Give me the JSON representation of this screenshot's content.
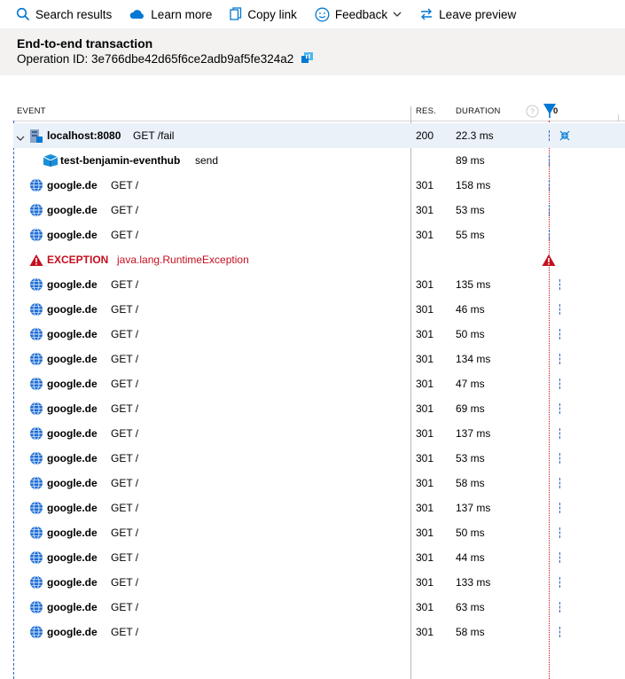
{
  "toolbar": {
    "search_results": "Search results",
    "learn_more": "Learn more",
    "copy_link": "Copy link",
    "feedback": "Feedback",
    "leave_preview": "Leave preview"
  },
  "header": {
    "title": "End-to-end transaction",
    "operation_id": "Operation ID: 3e766dbe42d65f6ce2adb9af5fe324a2"
  },
  "columns": {
    "event": "EVENT",
    "res": "RES.",
    "duration": "DURATION",
    "timeline_zero": "0"
  },
  "colors": {
    "accent": "#0078d4",
    "error": "#c50f1f",
    "header_bg": "#f3f2f1",
    "selected_row": "#eaf1f9"
  },
  "rows": [
    {
      "icon": "server-icon",
      "name": "localhost:8080",
      "detail": "GET /fail",
      "res": "200",
      "duration": "22.3 ms"
    },
    {
      "icon": "eventhub-icon",
      "name": "test-benjamin-eventhub",
      "detail": "send",
      "res": "",
      "duration": "89 ms"
    },
    {
      "icon": "globe-icon",
      "name": "google.de",
      "detail": "GET /",
      "res": "301",
      "duration": "158 ms"
    },
    {
      "icon": "globe-icon",
      "name": "google.de",
      "detail": "GET /",
      "res": "301",
      "duration": "53 ms"
    },
    {
      "icon": "globe-icon",
      "name": "google.de",
      "detail": "GET /",
      "res": "301",
      "duration": "55 ms"
    },
    {
      "icon": "warning-icon",
      "name": "EXCEPTION",
      "detail": "java.lang.RuntimeException",
      "res": "",
      "duration": ""
    },
    {
      "icon": "globe-icon",
      "name": "google.de",
      "detail": "GET /",
      "res": "301",
      "duration": "135 ms"
    },
    {
      "icon": "globe-icon",
      "name": "google.de",
      "detail": "GET /",
      "res": "301",
      "duration": "46 ms"
    },
    {
      "icon": "globe-icon",
      "name": "google.de",
      "detail": "GET /",
      "res": "301",
      "duration": "50 ms"
    },
    {
      "icon": "globe-icon",
      "name": "google.de",
      "detail": "GET /",
      "res": "301",
      "duration": "134 ms"
    },
    {
      "icon": "globe-icon",
      "name": "google.de",
      "detail": "GET /",
      "res": "301",
      "duration": "47 ms"
    },
    {
      "icon": "globe-icon",
      "name": "google.de",
      "detail": "GET /",
      "res": "301",
      "duration": "69 ms"
    },
    {
      "icon": "globe-icon",
      "name": "google.de",
      "detail": "GET /",
      "res": "301",
      "duration": "137 ms"
    },
    {
      "icon": "globe-icon",
      "name": "google.de",
      "detail": "GET /",
      "res": "301",
      "duration": "53 ms"
    },
    {
      "icon": "globe-icon",
      "name": "google.de",
      "detail": "GET /",
      "res": "301",
      "duration": "58 ms"
    },
    {
      "icon": "globe-icon",
      "name": "google.de",
      "detail": "GET /",
      "res": "301",
      "duration": "137 ms"
    },
    {
      "icon": "globe-icon",
      "name": "google.de",
      "detail": "GET /",
      "res": "301",
      "duration": "50 ms"
    },
    {
      "icon": "globe-icon",
      "name": "google.de",
      "detail": "GET /",
      "res": "301",
      "duration": "44 ms"
    },
    {
      "icon": "globe-icon",
      "name": "google.de",
      "detail": "GET /",
      "res": "301",
      "duration": "133 ms"
    },
    {
      "icon": "globe-icon",
      "name": "google.de",
      "detail": "GET /",
      "res": "301",
      "duration": "63 ms"
    },
    {
      "icon": "globe-icon",
      "name": "google.de",
      "detail": "GET /",
      "res": "301",
      "duration": "58 ms"
    }
  ]
}
